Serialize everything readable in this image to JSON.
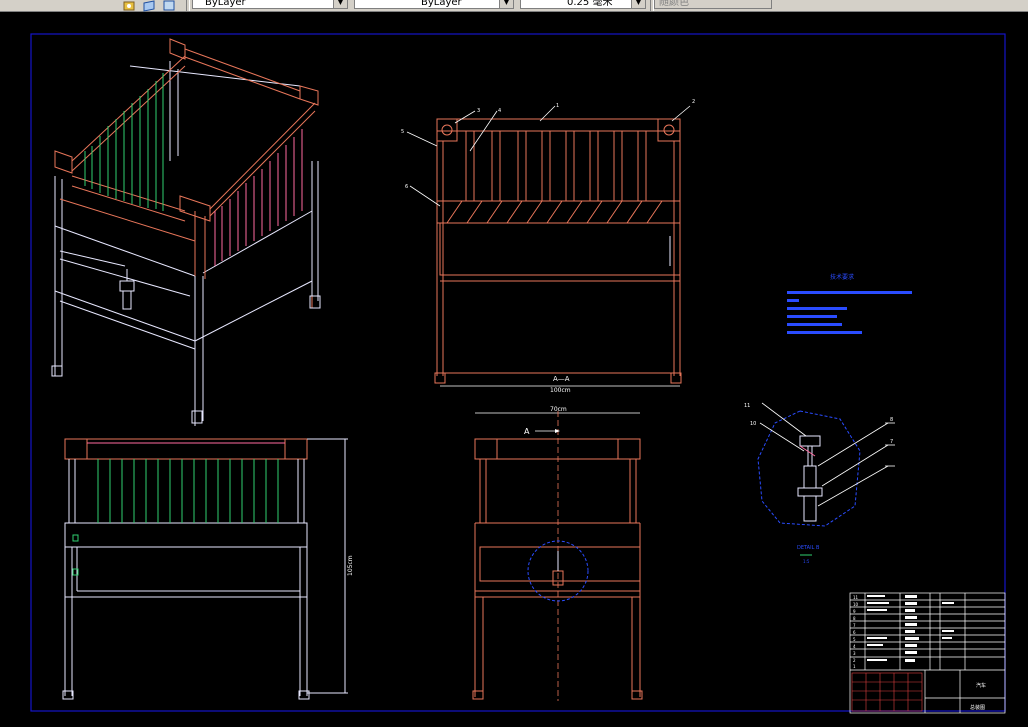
{
  "toolbar": {
    "layer_label": "ByLayer",
    "linetype_label": "ByLayer",
    "lineweight_label": "0.25 毫米",
    "color_label": "随颜色"
  },
  "drawing": {
    "view_label_section": "A—A",
    "view_label_section_dim": "100cm",
    "view_label_front_dim": "70cm",
    "view_label_front_marker": "A",
    "view_label_side_dim": "105cm",
    "detail_view_label": "DETAIL B",
    "detail_view_scale": "1:5",
    "callouts": {
      "c1": "1",
      "c2": "2",
      "c3": "3",
      "c4": "4",
      "c5": "5",
      "c6": "6",
      "c7": "7",
      "c8": "8",
      "c10": "10",
      "c11": "11"
    },
    "notes_title": "技术要求"
  },
  "title_block": {
    "rows": [
      "11",
      "10",
      "9",
      "8",
      "7",
      "6",
      "5",
      "4",
      "3",
      "2",
      "1"
    ],
    "company": "总装图",
    "sheet_label": "汽车"
  },
  "colors": {
    "background": "#000000",
    "border": "#1414c8",
    "frame": "#e8765a",
    "white_lines": "#ffffff",
    "green_bars": "#30d070",
    "blue_text": "#2a4cff",
    "pink": "#ff6aa0"
  }
}
